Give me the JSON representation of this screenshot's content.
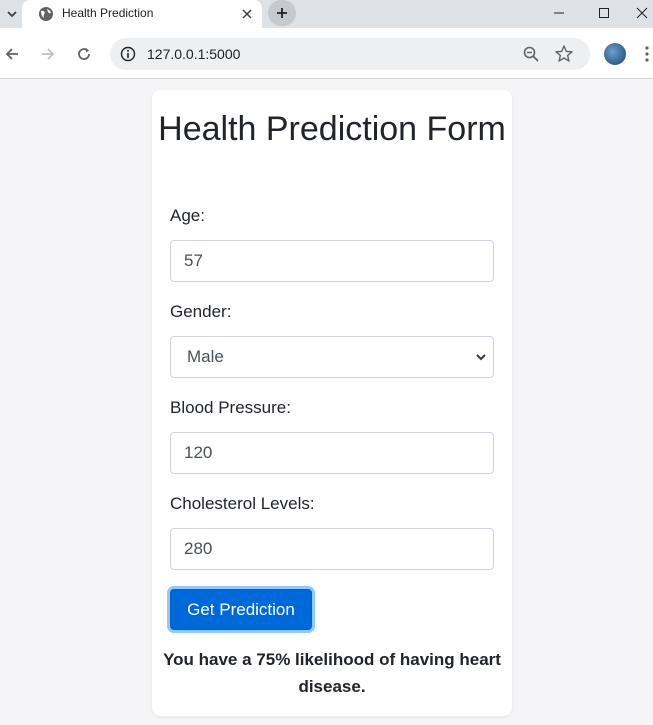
{
  "browser": {
    "tab_title": "Health Prediction",
    "url": "127.0.0.1:5000"
  },
  "form": {
    "title": "Health Prediction Form",
    "age_label": "Age:",
    "age_value": "57",
    "gender_label": "Gender:",
    "gender_value": "Male",
    "bp_label": "Blood Pressure:",
    "bp_value": "120",
    "chol_label": "Cholesterol Levels:",
    "chol_value": "280",
    "submit_label": "Get Prediction",
    "result_text": "You have a 75% likelihood of having heart disease."
  },
  "icons": {
    "tab_list": "chevron-down-icon",
    "favicon": "globe-icon",
    "tab_close": "close-icon",
    "new_tab": "plus-icon",
    "minimize": "minimize-icon",
    "maximize": "maximize-icon",
    "close_window": "close-icon",
    "back": "arrow-left-icon",
    "forward": "arrow-right-icon",
    "reload": "reload-icon",
    "site_info": "info-icon",
    "zoom": "zoom-icon",
    "bookmark": "star-icon",
    "profile": "avatar",
    "menu": "more-vertical-icon"
  },
  "colors": {
    "primary_button": "#0069d9",
    "page_background": "#f5f5f7",
    "card_background": "#ffffff"
  }
}
